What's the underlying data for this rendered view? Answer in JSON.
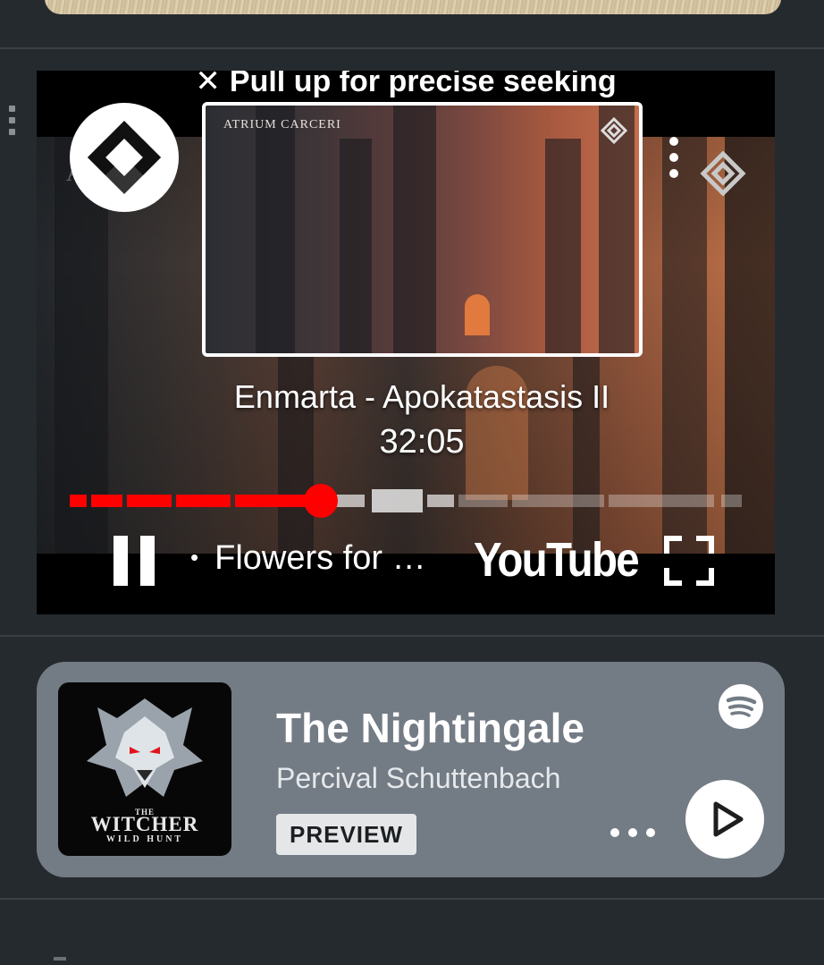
{
  "video_player": {
    "seek_hint": "Pull up for precise seeking",
    "seek_hint_icon": "close-icon",
    "preview_title": "ATRIUM CARCERI",
    "ghost_text": "AR",
    "title": "Enmarta - Apokatastasis II",
    "time": "32:05",
    "chapter": "Flowers for …",
    "brand": "YouTube",
    "accent_color": "#ff0000"
  },
  "track_card": {
    "title": "The Nightingale",
    "artist": "Percival Schuttenbach",
    "badge": "PREVIEW",
    "album_art": {
      "line1": "THE",
      "line2": "WITCHER",
      "line3": "WILD HUNT"
    },
    "card_color": "#737b84"
  }
}
